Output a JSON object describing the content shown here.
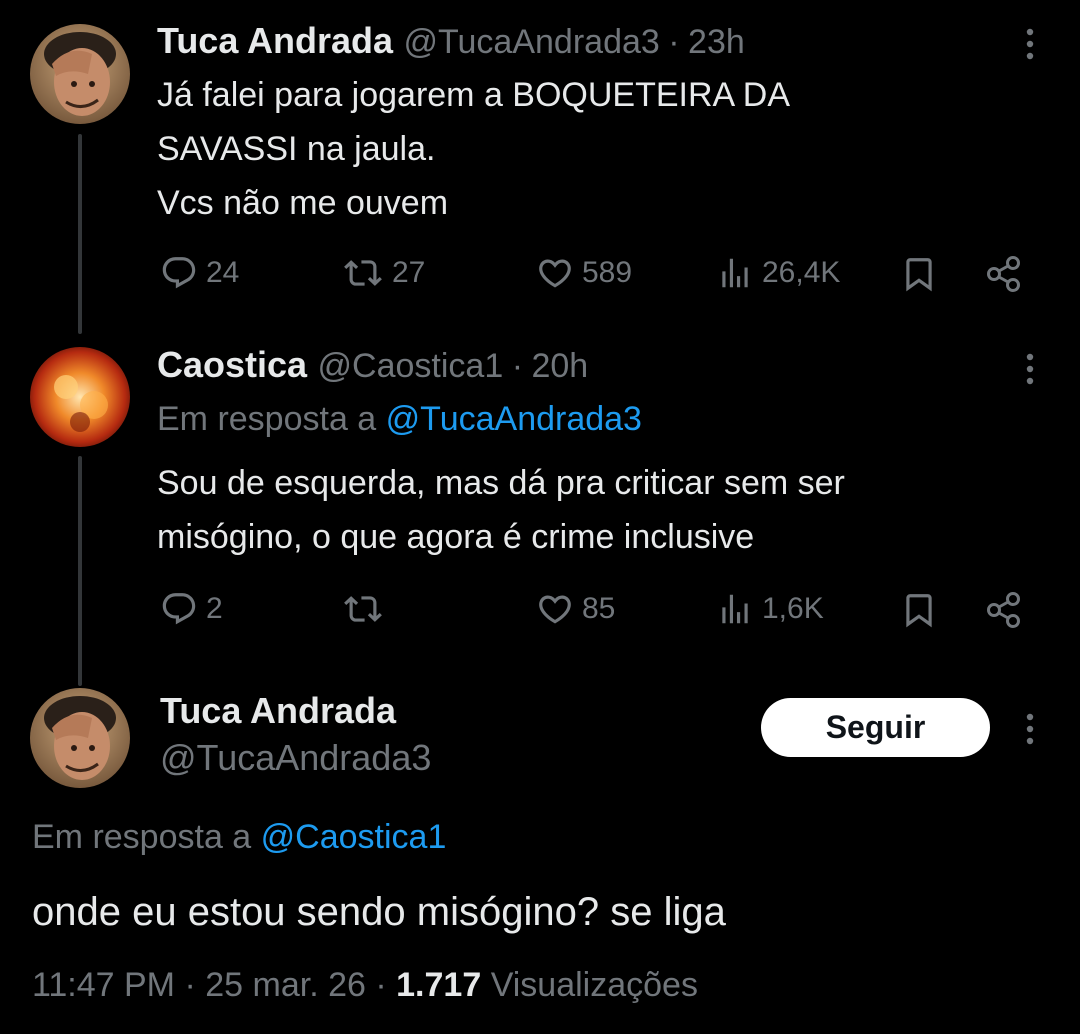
{
  "tweets": [
    {
      "author": "Tuca Andrada",
      "handle": "@TucaAndrada3",
      "sep": "·",
      "time": "23h",
      "text": "Já falei para jogarem a BOQUETEIRA DA\nSAVASSI na jaula.\nVcs não me ouvem",
      "replies": "24",
      "retweets": "27",
      "likes": "589",
      "views": "26,4K"
    },
    {
      "author": "Caostica",
      "handle": "@Caostica1",
      "sep": "·",
      "time": "20h",
      "reply_prefix": "Em resposta a",
      "reply_to": "@TucaAndrada3",
      "text": "Sou de esquerda, mas dá pra criticar sem ser\nmisógino, o que agora é crime inclusive",
      "replies": "2",
      "retweets": "",
      "likes": "85",
      "views": "1,6K"
    }
  ],
  "main_tweet": {
    "author": "Tuca Andrada",
    "handle": "@TucaAndrada3",
    "follow_label": "Seguir",
    "reply_prefix": "Em resposta a",
    "reply_to": "@Caostica1",
    "text": "onde eu estou sendo misógino? se liga",
    "time": "11:47 PM",
    "sep1": "·",
    "date": "25 mar. 26",
    "sep2": "·",
    "views_count": "1.717",
    "views_label": "Visualizações"
  },
  "icons": {
    "reply": "reply-icon",
    "retweet": "retweet-icon",
    "like": "heart-icon",
    "views": "analytics-icon",
    "bookmark": "bookmark-icon",
    "share": "share-icon",
    "more": "more-icon"
  },
  "colors": {
    "background": "#000000",
    "text": "#e7e9ea",
    "muted": "#71767b",
    "link": "#1d9bf0",
    "thread_line": "#333639"
  }
}
